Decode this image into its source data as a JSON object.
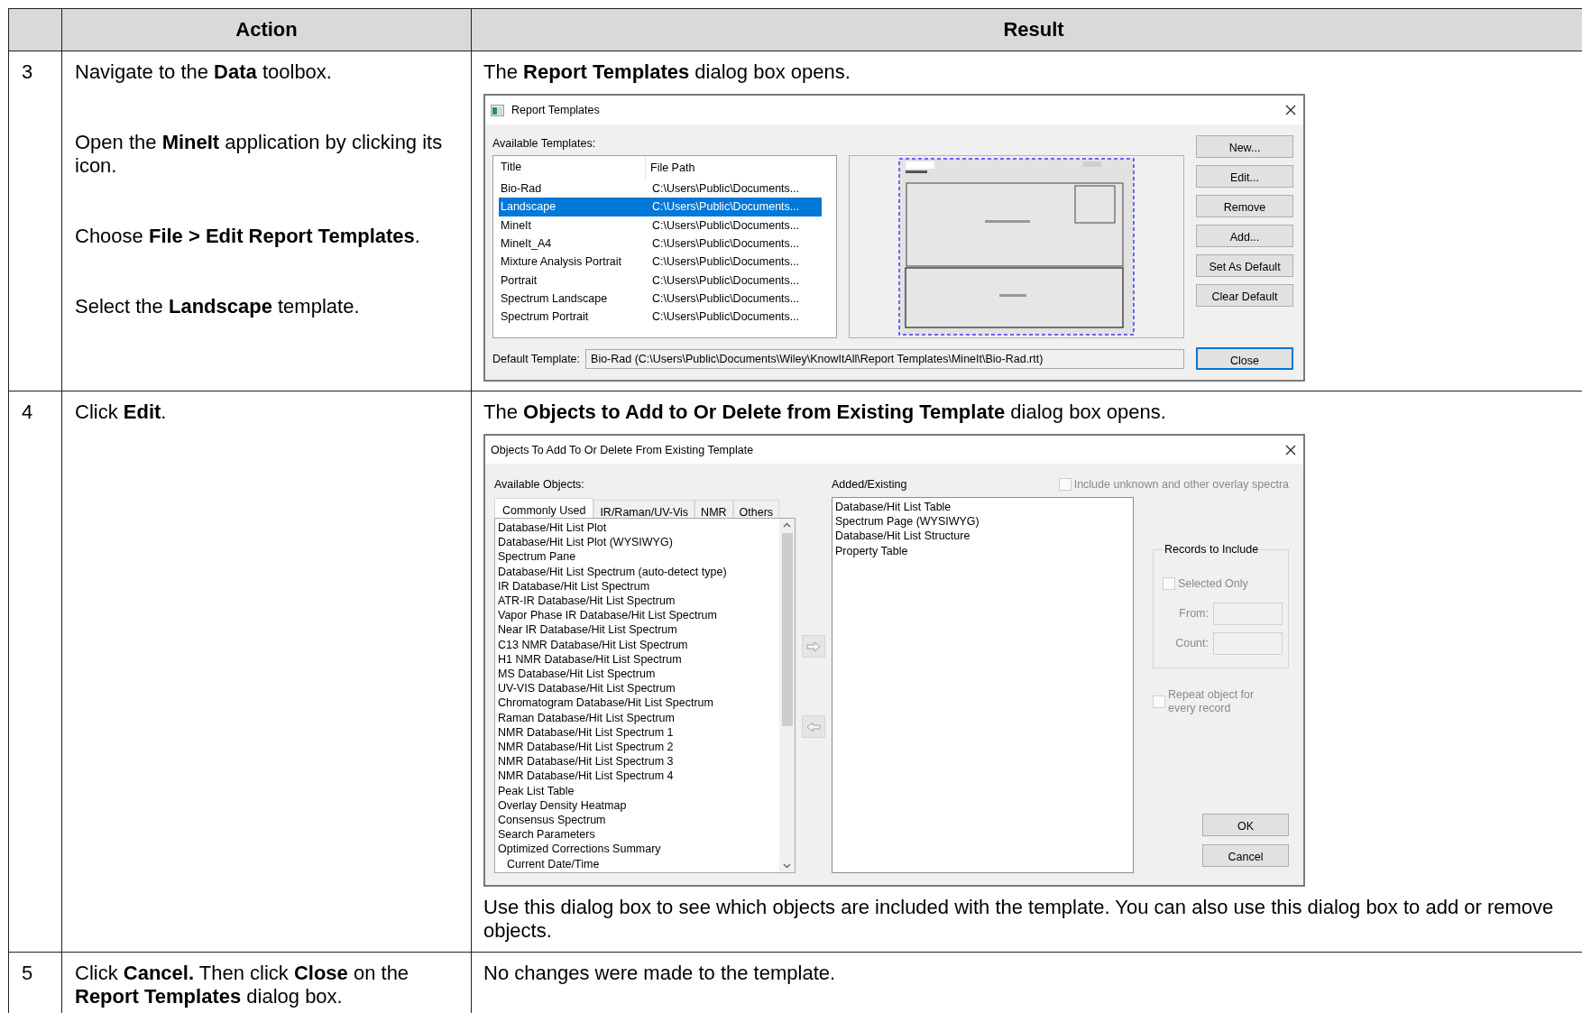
{
  "table": {
    "columns": [
      "Action",
      "Result"
    ],
    "steps": [
      {
        "number": "3",
        "actions": [
          "Navigate to the **Data** toolbox.",
          "Open the **MineIt** application by clicking its icon.",
          "Choose **File > Edit Report Templates**.",
          "Select the **Landscape** template."
        ],
        "result": {
          "text": "The **Report Templates** dialog box opens.",
          "dialog": {
            "kind": "report_templates",
            "title": "Report Templates",
            "list_label": "Available Templates:",
            "columns": [
              "Title",
              "File Path"
            ],
            "templates": [
              {
                "title": "Bio-Rad",
                "path": "C:\\Users\\Public\\Documents...",
                "selected": false
              },
              {
                "title": "Landscape",
                "path": "C:\\Users\\Public\\Documents...",
                "selected": true
              },
              {
                "title": "MineIt",
                "path": "C:\\Users\\Public\\Documents...",
                "selected": false
              },
              {
                "title": "MineIt_A4",
                "path": "C:\\Users\\Public\\Documents...",
                "selected": false
              },
              {
                "title": "Mixture Analysis Portrait",
                "path": "C:\\Users\\Public\\Documents...",
                "selected": false
              },
              {
                "title": "Portrait",
                "path": "C:\\Users\\Public\\Documents...",
                "selected": false
              },
              {
                "title": "Spectrum Landscape",
                "path": "C:\\Users\\Public\\Documents...",
                "selected": false
              },
              {
                "title": "Spectrum Portrait",
                "path": "C:\\Users\\Public\\Documents...",
                "selected": false
              }
            ],
            "buttons": [
              {
                "label": "New...",
                "focused": false
              },
              {
                "label": "Edit...",
                "focused": false
              },
              {
                "label": "Remove",
                "focused": false
              },
              {
                "label": "Add...",
                "focused": false
              },
              {
                "label": "Set As Default",
                "focused": false
              },
              {
                "label": "Clear Default",
                "focused": false
              }
            ],
            "default_label": "Default Template:",
            "default_value": "Bio-Rad (C:\\Users\\Public\\Documents\\Wiley\\KnowItAll\\Report Templates\\MineIt\\Bio-Rad.rtt)",
            "close_button": {
              "label": "Close",
              "focused": true
            }
          }
        }
      },
      {
        "number": "4",
        "actions": [
          "Click **Edit**."
        ],
        "result": {
          "text": "The **Objects to Add to Or Delete from Existing Template** dialog box opens.",
          "dialog": {
            "kind": "objects",
            "title": "Objects To Add To Or Delete From Existing Template",
            "available_label": "Available Objects:",
            "tabs": [
              {
                "label": "Commonly Used",
                "selected": true
              },
              {
                "label": "IR/Raman/UV-Vis",
                "selected": false
              },
              {
                "label": "NMR",
                "selected": false
              },
              {
                "label": "Others",
                "selected": false
              }
            ],
            "available_items": [
              {
                "label": "Database/Hit List Plot",
                "kind": "entry"
              },
              {
                "label": "Database/Hit List Plot (WYSIWYG)",
                "kind": "entry"
              },
              {
                "label": "Spectrum Pane",
                "kind": "entry"
              },
              {
                "label": "Database/Hit List Spectrum (auto-detect type)",
                "kind": "entry"
              },
              {
                "label": "IR Database/Hit List Spectrum",
                "kind": "entry"
              },
              {
                "label": "ATR-IR Database/Hit List Spectrum",
                "kind": "entry"
              },
              {
                "label": "Vapor Phase IR Database/Hit List Spectrum",
                "kind": "entry"
              },
              {
                "label": "Near IR Database/Hit List Spectrum",
                "kind": "entry"
              },
              {
                "label": "C13 NMR Database/Hit List Spectrum",
                "kind": "entry"
              },
              {
                "label": "H1 NMR Database/Hit List Spectrum",
                "kind": "entry"
              },
              {
                "label": "MS Database/Hit List Spectrum",
                "kind": "entry"
              },
              {
                "label": "UV-VIS Database/Hit List Spectrum",
                "kind": "entry"
              },
              {
                "label": "Chromatogram Database/Hit List Spectrum",
                "kind": "entry"
              },
              {
                "label": "Raman Database/Hit List Spectrum",
                "kind": "entry"
              },
              {
                "label": "NMR Database/Hit List Spectrum 1",
                "kind": "entry"
              },
              {
                "label": "NMR Database/Hit List Spectrum 2",
                "kind": "entry"
              },
              {
                "label": "NMR Database/Hit List Spectrum 3",
                "kind": "entry"
              },
              {
                "label": "NMR Database/Hit List Spectrum 4",
                "kind": "entry"
              },
              {
                "label": "Peak List Table",
                "kind": "entry"
              },
              {
                "label": "Overlay Density Heatmap",
                "kind": "entry"
              },
              {
                "label": "Consensus Spectrum",
                "kind": "entry"
              },
              {
                "label": "Search Parameters",
                "kind": "entry"
              },
              {
                "label": "Optimized Corrections Summary",
                "kind": "entry"
              },
              {
                "label": "Current Date/Time",
                "kind": "indented"
              }
            ],
            "added_label": "Added/Existing",
            "added_items": [
              "Database/Hit List Table",
              "Spectrum Page (WYSIWYG)",
              "Database/Hit List Structure",
              "Property Table"
            ],
            "include_overlay": {
              "label": "Include unknown and other overlay spectra",
              "checked": false,
              "disabled": true
            },
            "records": {
              "title": "Records to Include",
              "disabled": true,
              "selected_only": {
                "label": "Selected Only",
                "checked": false
              },
              "from_label": "From:",
              "count_label": "Count:"
            },
            "repeat": {
              "label": "Repeat object for every record",
              "checked": false,
              "disabled": true
            },
            "buttons": [
              "OK",
              "Cancel"
            ]
          },
          "note": "Use this dialog box to see which objects are included with the template. You can also use this dialog box to add or remove objects."
        }
      },
      {
        "number": "5",
        "actions": [
          "Click **Cancel.** Then click **Close** on the **Report Templates** dialog box."
        ],
        "result": {
          "text": "No changes were made to the template."
        }
      }
    ]
  }
}
